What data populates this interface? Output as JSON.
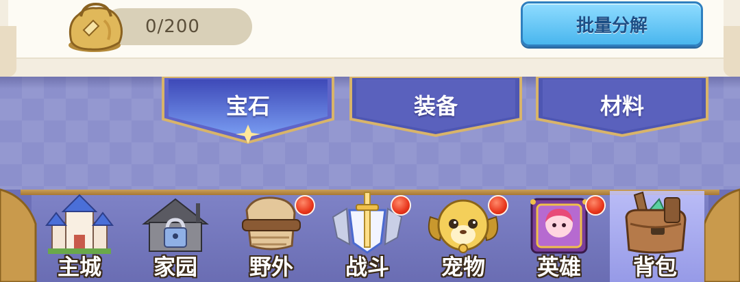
{
  "header": {
    "capacity": "0/200",
    "batch_button_label": "批量分解"
  },
  "category_tabs": [
    {
      "label": "宝石",
      "active": true
    },
    {
      "label": "装备",
      "active": false
    },
    {
      "label": "材料",
      "active": false
    }
  ],
  "nav": [
    {
      "label": "主城",
      "icon": "castle-icon",
      "badge": false
    },
    {
      "label": "家园",
      "icon": "locked-house-icon",
      "badge": false
    },
    {
      "label": "野外",
      "icon": "scroll-icon",
      "badge": true
    },
    {
      "label": "战斗",
      "icon": "sword-shield-icon",
      "badge": true
    },
    {
      "label": "宠物",
      "icon": "dog-pet-icon",
      "badge": true
    },
    {
      "label": "英雄",
      "icon": "hero-book-icon",
      "badge": true
    },
    {
      "label": "背包",
      "icon": "backpack-icon",
      "badge": false,
      "active": true
    }
  ],
  "colors": {
    "accent_blue": "#49b6ee",
    "tab_purple": "#8c90cc",
    "badge_red": "#e8361c",
    "cream": "#fdfbf4"
  }
}
